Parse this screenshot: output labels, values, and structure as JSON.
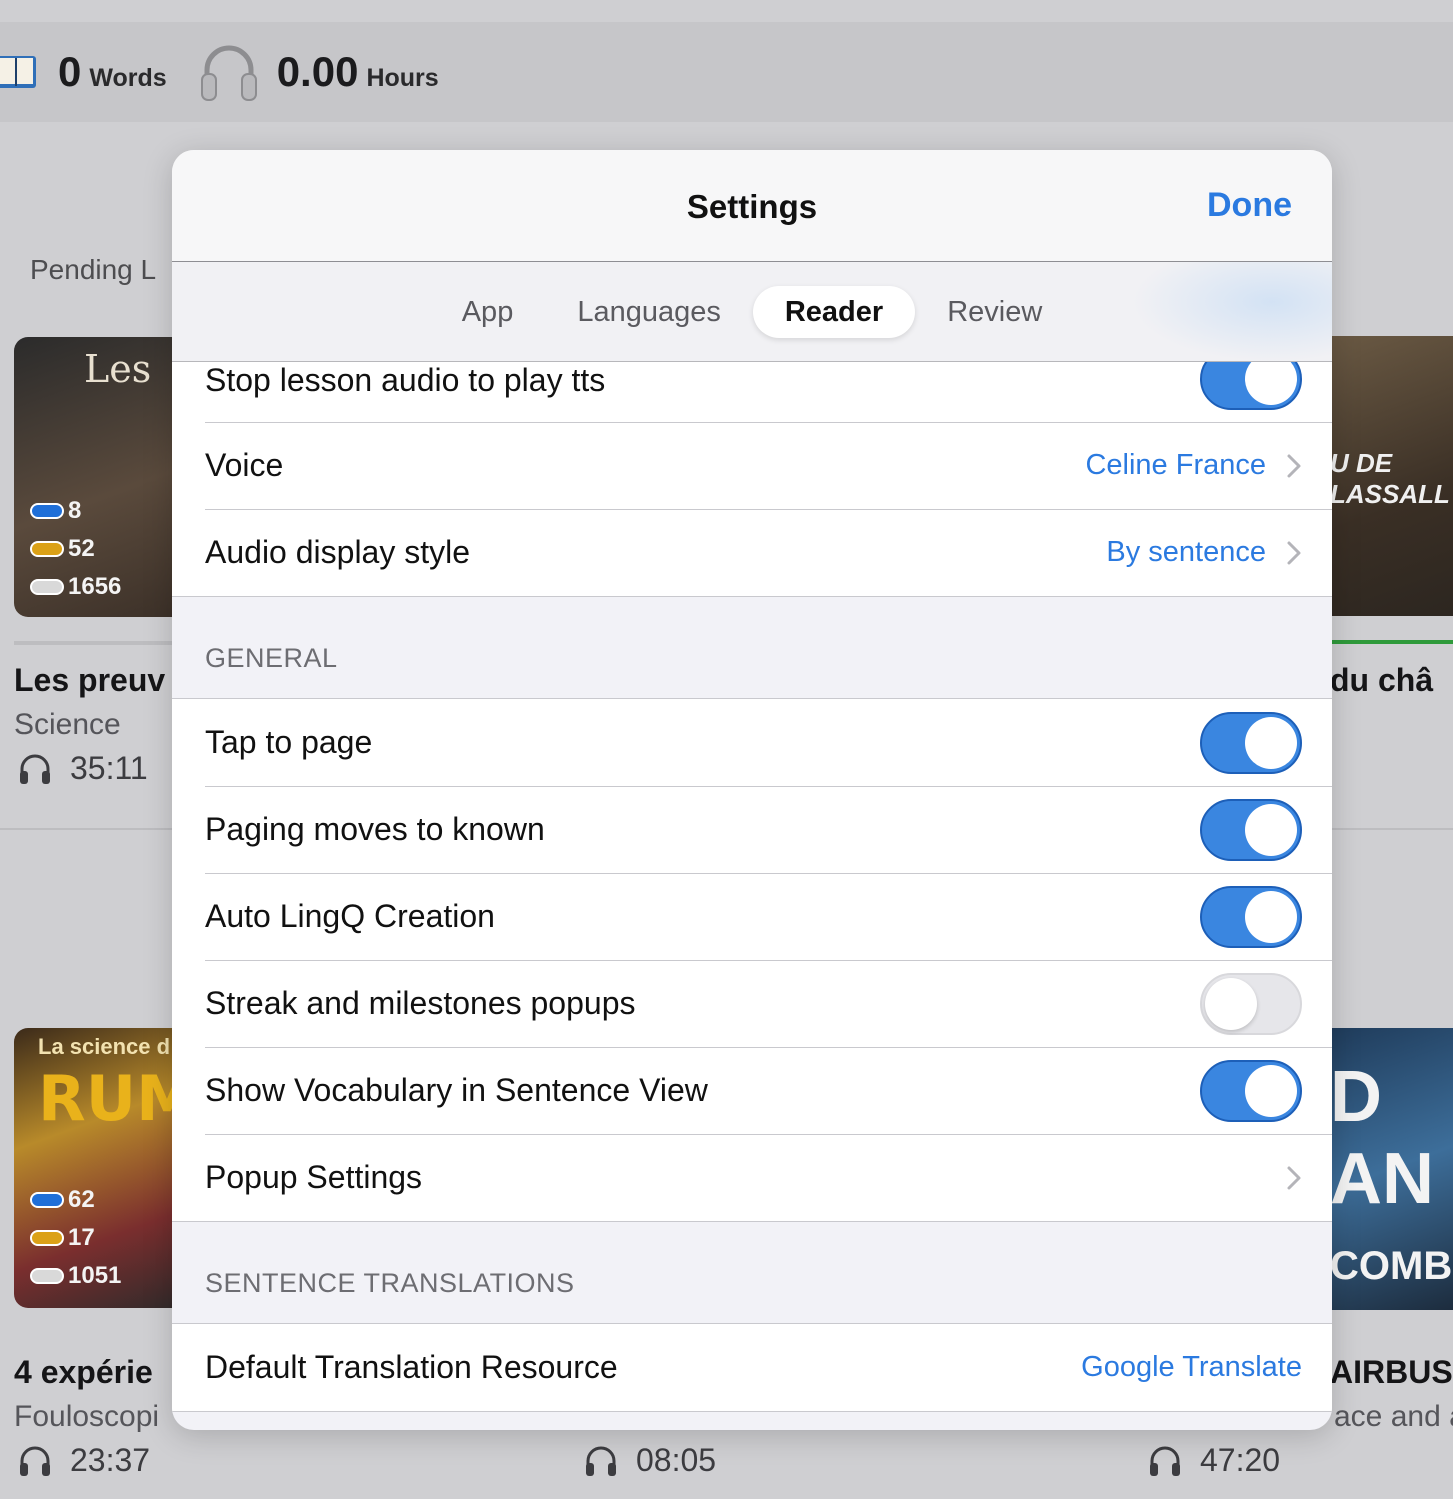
{
  "topbar": {
    "words_value": "0",
    "words_unit": "Words",
    "hours_value": "0.00",
    "hours_unit": "Hours"
  },
  "background": {
    "pending_label": "Pending L",
    "cards": [
      {
        "thumb_art": "Les",
        "known": "8",
        "lingqs": "52",
        "new": "1656",
        "title": "Les preuv",
        "subtitle": "Science",
        "duration": "35:11",
        "progress_color": "#bdbdc0"
      },
      {
        "thumb_art": "U DE LASSALL",
        "title": "du châ",
        "progress_color": "#2f9a3b"
      },
      {
        "thumb_art_small": "La science d",
        "thumb_art": "RUM",
        "known": "62",
        "lingqs": "17",
        "new": "1051",
        "title": "4 expérie",
        "subtitle": "Fouloscopi",
        "duration": "23:37"
      },
      {
        "duration": "08:05"
      },
      {
        "thumb_art": "D AN",
        "thumb_art_bottom": "COMBA",
        "title": "AIRBUS",
        "subtitle": "ace and a",
        "duration": "47:20"
      }
    ]
  },
  "modal": {
    "title": "Settings",
    "done_label": "Done",
    "tabs": [
      {
        "label": "App",
        "active": false
      },
      {
        "label": "Languages",
        "active": false
      },
      {
        "label": "Reader",
        "active": true
      },
      {
        "label": "Review",
        "active": false
      }
    ],
    "audio_rows": [
      {
        "label": "Stop lesson audio to play tts",
        "type": "toggle",
        "on": true
      },
      {
        "label": "Voice",
        "type": "value",
        "value": "Celine France"
      },
      {
        "label": "Audio display style",
        "type": "value",
        "value": "By sentence"
      }
    ],
    "general_header": "GENERAL",
    "general_rows": [
      {
        "label": "Tap to page",
        "type": "toggle",
        "on": true
      },
      {
        "label": "Paging moves to known",
        "type": "toggle",
        "on": true
      },
      {
        "label": "Auto LingQ Creation",
        "type": "toggle",
        "on": true
      },
      {
        "label": "Streak and milestones popups",
        "type": "toggle",
        "on": false
      },
      {
        "label": "Show Vocabulary in Sentence View",
        "type": "toggle",
        "on": true
      },
      {
        "label": "Popup Settings",
        "type": "link"
      }
    ],
    "translations_header": "SENTENCE TRANSLATIONS",
    "translations_rows": [
      {
        "label": "Default Translation Resource",
        "type": "value",
        "value": "Google Translate"
      }
    ]
  },
  "colors": {
    "accent": "#2b7ae0",
    "toggle_on": "#3a86e0",
    "toggle_off": "#e6e6ea"
  }
}
